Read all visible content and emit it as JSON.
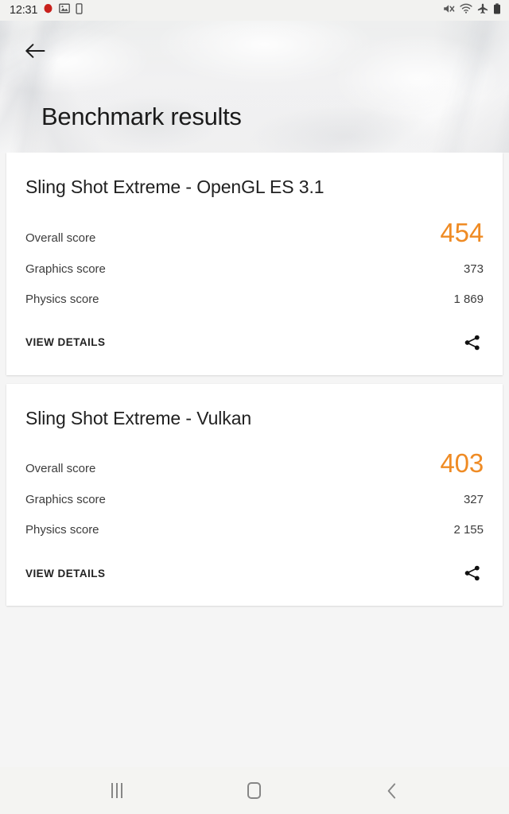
{
  "statusbar": {
    "time": "12:31",
    "left_icons": [
      {
        "name": "recording-dot-icon",
        "label": "recording"
      },
      {
        "name": "screenshot-image-icon",
        "label": "image"
      },
      {
        "name": "sim-card-icon",
        "label": "sim"
      }
    ],
    "right_icons": [
      {
        "name": "mute-icon",
        "label": "sound off"
      },
      {
        "name": "wifi-icon",
        "label": "wifi"
      },
      {
        "name": "airplane-mode-icon",
        "label": "airplane mode"
      },
      {
        "name": "battery-icon",
        "label": "battery"
      }
    ]
  },
  "header": {
    "back_label": "Back",
    "title": "Benchmark results"
  },
  "cards": [
    {
      "title": "Sling Shot Extreme - OpenGL ES 3.1",
      "overall_label": "Overall score",
      "overall_value": "454",
      "graphics_label": "Graphics score",
      "graphics_value": "373",
      "physics_label": "Physics score",
      "physics_value": "1 869",
      "details_label": "VIEW DETAILS",
      "share_label": "Share"
    },
    {
      "title": "Sling Shot Extreme - Vulkan",
      "overall_label": "Overall score",
      "overall_value": "403",
      "graphics_label": "Graphics score",
      "graphics_value": "327",
      "physics_label": "Physics score",
      "physics_value": "2 155",
      "details_label": "VIEW DETAILS",
      "share_label": "Share"
    }
  ],
  "navbar": {
    "recents_label": "Recents",
    "home_label": "Home",
    "back_label": "Back"
  },
  "colors": {
    "accent_orange": "#ef8b24",
    "card_background": "#ffffff",
    "page_background": "#f5f5f5",
    "text_primary": "#212121",
    "text_secondary": "#3c3c3c"
  }
}
